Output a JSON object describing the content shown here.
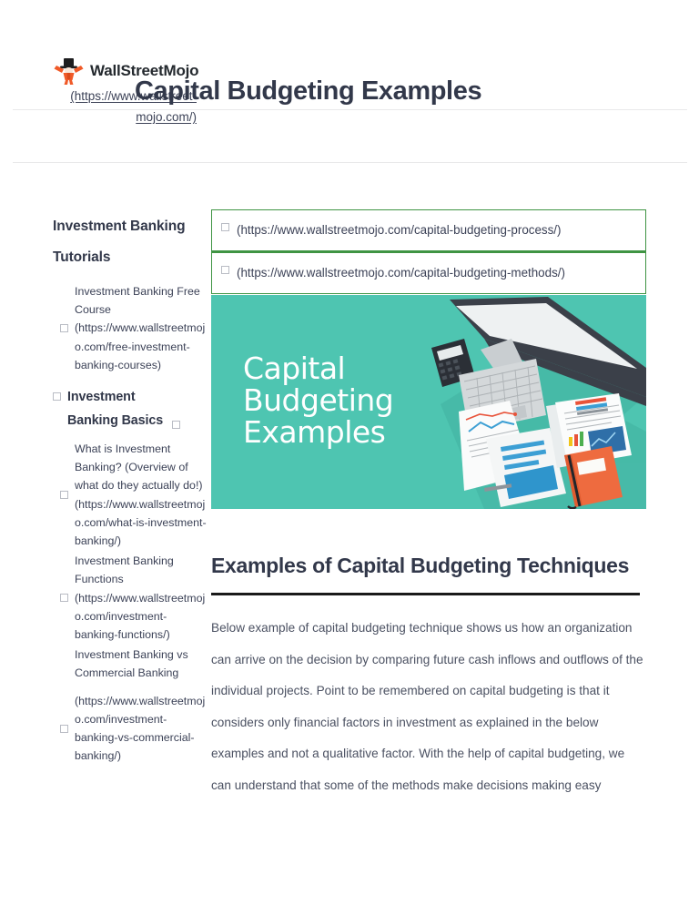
{
  "header": {
    "brand_name": "WallStreetMojo",
    "brand_url": "(https://www.wallstreet-mojo.com/)",
    "page_title": "Capital Budgeting Examples",
    "logo_icon": "wallstreetmojo-mascot-icon"
  },
  "sidebar": {
    "title": "Investment Banking Tutorials",
    "items": [
      {
        "label": "Investment Banking Free Course (https://www.wallstreetmojo.com/free-investment-banking-courses)",
        "icon": "empty-box-glyph"
      }
    ],
    "category": {
      "label_part1": "Investment",
      "label_part2": "Banking Basics",
      "icon_leading": "empty-box-glyph",
      "icon_trailing": "empty-box-glyph"
    },
    "category_items": [
      {
        "label": "What is Investment Banking? (Overview of what do they actually do!) (https://www.wallstreetmojo.com/what-is-investment-banking/)",
        "icon": "empty-box-glyph"
      },
      {
        "label": "Investment Banking Functions (https://www.wallstreetmojo.com/investment-banking-functions/)",
        "icon": "empty-box-glyph"
      },
      {
        "label": "Investment Banking vs Commercial Banking",
        "icon": null
      },
      {
        "label": "(https://www.wallstreetmojo.com/investment-banking-vs-commercial-banking/)",
        "icon": "empty-box-glyph"
      }
    ]
  },
  "main": {
    "link_boxes": [
      {
        "text": "(https://www.wallstreetmojo.com/capital-budgeting-process/)",
        "icon": "empty-box-glyph",
        "border_color": "#3f9443"
      },
      {
        "text": "(https://www.wallstreetmojo.com/capital-budgeting-methods/)",
        "icon": "empty-box-glyph",
        "border_color": "#3f9443"
      }
    ],
    "banner": {
      "line1": "Capital",
      "line2": "Budgeting",
      "line3": "Examples",
      "background_color": "#4ec5b1",
      "text_color": "#ffffff",
      "illustration": "desk-with-monitor-keyboard-calculator-documents-notebook"
    },
    "section_heading": "Examples of Capital Budgeting Techniques",
    "paragraph": "Below example of capital budgeting technique shows us how an organization can arrive on the decision by comparing future cash inflows and outflows of the individual projects. Point to be remembered on capital budgeting is that it considers only financial factors in investment as explained in the below examples and not a qualitative factor. With the help of capital budgeting, we can understand that some of the methods make decisions making easy"
  }
}
